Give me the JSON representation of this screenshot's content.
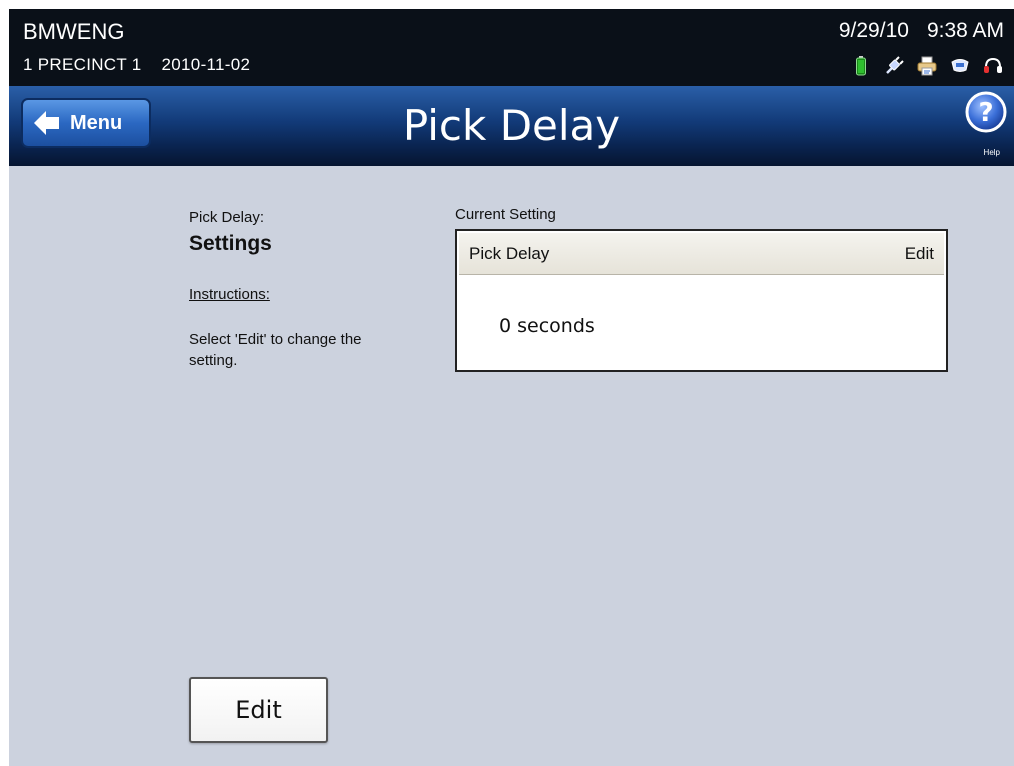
{
  "status": {
    "user": "BMWENG",
    "precinct": "1 PRECINCT 1",
    "election_date": "2010-11-02",
    "date": "9/29/10",
    "time": "9:38 AM",
    "icons": [
      "battery-icon",
      "power-plug-icon",
      "printer-icon",
      "memory-card-icon",
      "audio-headset-icon"
    ]
  },
  "header": {
    "menu_label": "Menu",
    "title": "Pick Delay",
    "help_label": "Help"
  },
  "left": {
    "section_label": "Pick Delay:",
    "section_heading": "Settings",
    "instructions_title": "Instructions:",
    "instructions_text": "Select 'Edit' to change the setting."
  },
  "setting": {
    "label": "Current Setting",
    "name": "Pick Delay",
    "edit_label": "Edit",
    "value": "0 seconds"
  },
  "footer": {
    "edit_button_label": "Edit"
  },
  "colors": {
    "background": "#ccd2de",
    "status_bar": "#0a1018",
    "title_bar": "#123a78",
    "menu_button": "#2b68c2",
    "battery": "#2fbf2f"
  }
}
